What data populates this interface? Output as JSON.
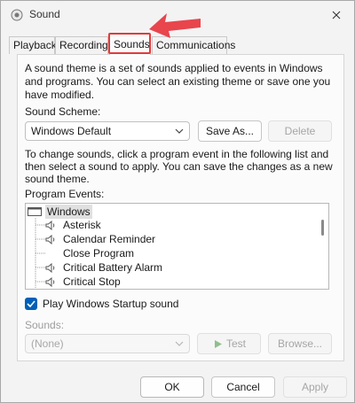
{
  "window": {
    "title": "Sound",
    "close_icon": "close-icon"
  },
  "tabs": [
    {
      "label": "Playback",
      "active": false
    },
    {
      "label": "Recording",
      "active": false
    },
    {
      "label": "Sounds",
      "active": true
    },
    {
      "label": "Communications",
      "active": false
    }
  ],
  "sounds": {
    "description": [
      "A sound theme is a set of sounds applied to events in Windows",
      "and programs.  You can select an existing theme or save one you",
      "have modified."
    ],
    "scheme_label": "Sound Scheme:",
    "scheme_value": "Windows Default",
    "save_as_label": "Save As...",
    "delete_label": "Delete",
    "instructions": [
      "To change sounds, click a program event in the following list and",
      "then select a sound to apply.  You can save the changes as a new",
      "sound theme."
    ],
    "events_label": "Program Events:",
    "events": [
      {
        "label": "Windows",
        "level": 0,
        "has_sound": false
      },
      {
        "label": "Asterisk",
        "level": 1,
        "has_sound": true
      },
      {
        "label": "Calendar Reminder",
        "level": 1,
        "has_sound": true
      },
      {
        "label": "Close Program",
        "level": 1,
        "has_sound": false
      },
      {
        "label": "Critical Battery Alarm",
        "level": 1,
        "has_sound": true
      },
      {
        "label": "Critical Stop",
        "level": 1,
        "has_sound": true
      }
    ],
    "startup_label": "Play Windows Startup sound",
    "startup_checked": true,
    "sounds_label": "Sounds:",
    "sound_value": "(None)",
    "test_label": "Test",
    "browse_label": "Browse..."
  },
  "footer": {
    "ok_label": "OK",
    "cancel_label": "Cancel",
    "apply_label": "Apply"
  },
  "colors": {
    "accent": "#005fb8",
    "highlight_red": "#e23a3a"
  }
}
